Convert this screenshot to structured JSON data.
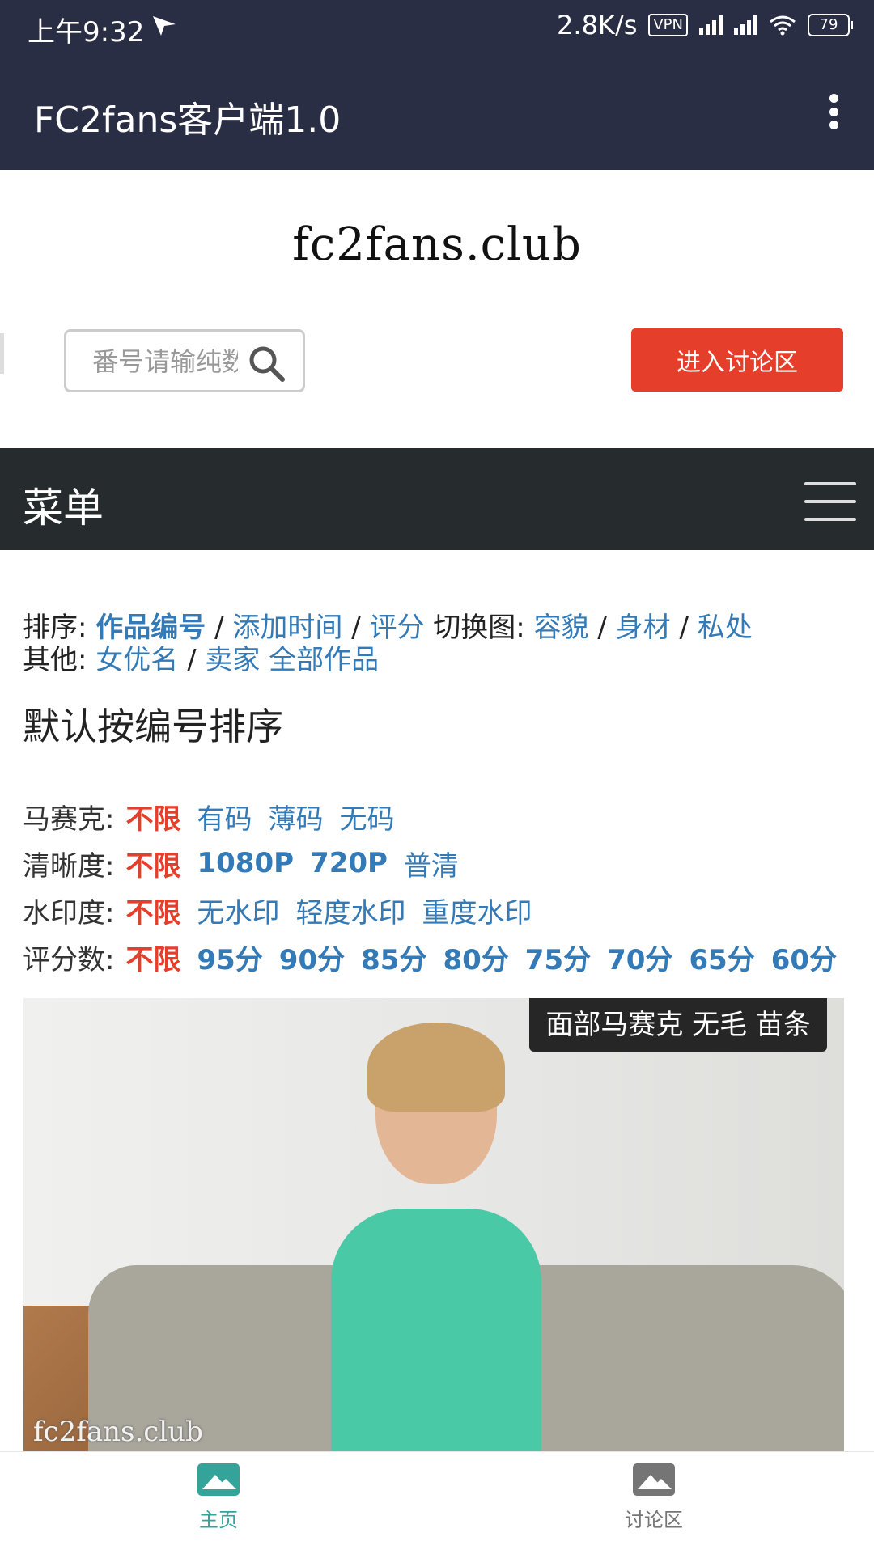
{
  "status_bar": {
    "time": "上午9:32",
    "speed": "2.8K/s",
    "vpn": "VPN",
    "battery": "79"
  },
  "appbar": {
    "title": "FC2fans客户端1.0"
  },
  "logo": "fc2fans.club",
  "search": {
    "placeholder": "番号请输纯数字"
  },
  "discuss_button": "进入讨论区",
  "menu": {
    "label": "菜单"
  },
  "sort": {
    "label": "排序:",
    "options": [
      "作品编号",
      "添加时间",
      "评分"
    ],
    "switch_label": "切换图:",
    "switch_options": [
      "容貌",
      "身材",
      "私处"
    ],
    "other_label": "其他:",
    "other_options": [
      "女优名",
      "卖家 全部作品"
    ]
  },
  "heading": "默认按编号排序",
  "filters": [
    {
      "label": "马赛克:",
      "options": [
        "不限",
        "有码",
        "薄码",
        "无码"
      ]
    },
    {
      "label": "清晰度:",
      "options": [
        "不限",
        "1080P",
        "720P",
        "普清"
      ]
    },
    {
      "label": "水印度:",
      "options": [
        "不限",
        "无水印",
        "轻度水印",
        "重度水印"
      ]
    },
    {
      "label": "评分数:",
      "options": [
        "不限",
        "95分",
        "90分",
        "85分",
        "80分",
        "75分",
        "70分",
        "65分",
        "60分"
      ]
    }
  ],
  "card": {
    "tag": "面部马赛克 无毛 苗条",
    "watermark": "fc2fans.club"
  },
  "bottom_nav": {
    "home": "主页",
    "discuss": "讨论区"
  },
  "colors": {
    "appbar": "#2a2e45",
    "menubar": "#262b2e",
    "accent_red": "#e53e2b",
    "link_blue": "#337ab7",
    "nav_active": "#34a39a"
  }
}
